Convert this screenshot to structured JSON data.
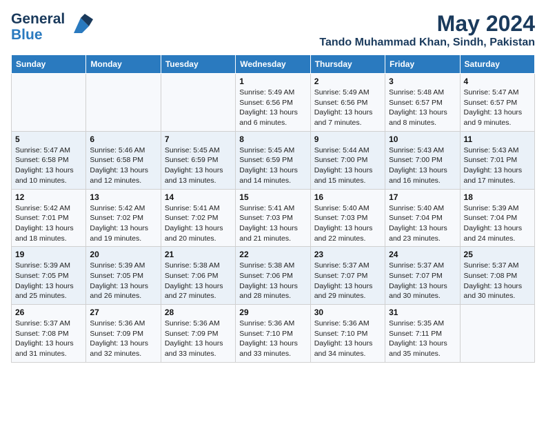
{
  "logo": {
    "line1": "General",
    "line2": "Blue"
  },
  "title": "May 2024",
  "subtitle": "Tando Muhammad Khan, Sindh, Pakistan",
  "days_of_week": [
    "Sunday",
    "Monday",
    "Tuesday",
    "Wednesday",
    "Thursday",
    "Friday",
    "Saturday"
  ],
  "weeks": [
    [
      {
        "day": "",
        "info": ""
      },
      {
        "day": "",
        "info": ""
      },
      {
        "day": "",
        "info": ""
      },
      {
        "day": "1",
        "info": "Sunrise: 5:49 AM\nSunset: 6:56 PM\nDaylight: 13 hours\nand 6 minutes."
      },
      {
        "day": "2",
        "info": "Sunrise: 5:49 AM\nSunset: 6:56 PM\nDaylight: 13 hours\nand 7 minutes."
      },
      {
        "day": "3",
        "info": "Sunrise: 5:48 AM\nSunset: 6:57 PM\nDaylight: 13 hours\nand 8 minutes."
      },
      {
        "day": "4",
        "info": "Sunrise: 5:47 AM\nSunset: 6:57 PM\nDaylight: 13 hours\nand 9 minutes."
      }
    ],
    [
      {
        "day": "5",
        "info": "Sunrise: 5:47 AM\nSunset: 6:58 PM\nDaylight: 13 hours\nand 10 minutes."
      },
      {
        "day": "6",
        "info": "Sunrise: 5:46 AM\nSunset: 6:58 PM\nDaylight: 13 hours\nand 12 minutes."
      },
      {
        "day": "7",
        "info": "Sunrise: 5:45 AM\nSunset: 6:59 PM\nDaylight: 13 hours\nand 13 minutes."
      },
      {
        "day": "8",
        "info": "Sunrise: 5:45 AM\nSunset: 6:59 PM\nDaylight: 13 hours\nand 14 minutes."
      },
      {
        "day": "9",
        "info": "Sunrise: 5:44 AM\nSunset: 7:00 PM\nDaylight: 13 hours\nand 15 minutes."
      },
      {
        "day": "10",
        "info": "Sunrise: 5:43 AM\nSunset: 7:00 PM\nDaylight: 13 hours\nand 16 minutes."
      },
      {
        "day": "11",
        "info": "Sunrise: 5:43 AM\nSunset: 7:01 PM\nDaylight: 13 hours\nand 17 minutes."
      }
    ],
    [
      {
        "day": "12",
        "info": "Sunrise: 5:42 AM\nSunset: 7:01 PM\nDaylight: 13 hours\nand 18 minutes."
      },
      {
        "day": "13",
        "info": "Sunrise: 5:42 AM\nSunset: 7:02 PM\nDaylight: 13 hours\nand 19 minutes."
      },
      {
        "day": "14",
        "info": "Sunrise: 5:41 AM\nSunset: 7:02 PM\nDaylight: 13 hours\nand 20 minutes."
      },
      {
        "day": "15",
        "info": "Sunrise: 5:41 AM\nSunset: 7:03 PM\nDaylight: 13 hours\nand 21 minutes."
      },
      {
        "day": "16",
        "info": "Sunrise: 5:40 AM\nSunset: 7:03 PM\nDaylight: 13 hours\nand 22 minutes."
      },
      {
        "day": "17",
        "info": "Sunrise: 5:40 AM\nSunset: 7:04 PM\nDaylight: 13 hours\nand 23 minutes."
      },
      {
        "day": "18",
        "info": "Sunrise: 5:39 AM\nSunset: 7:04 PM\nDaylight: 13 hours\nand 24 minutes."
      }
    ],
    [
      {
        "day": "19",
        "info": "Sunrise: 5:39 AM\nSunset: 7:05 PM\nDaylight: 13 hours\nand 25 minutes."
      },
      {
        "day": "20",
        "info": "Sunrise: 5:39 AM\nSunset: 7:05 PM\nDaylight: 13 hours\nand 26 minutes."
      },
      {
        "day": "21",
        "info": "Sunrise: 5:38 AM\nSunset: 7:06 PM\nDaylight: 13 hours\nand 27 minutes."
      },
      {
        "day": "22",
        "info": "Sunrise: 5:38 AM\nSunset: 7:06 PM\nDaylight: 13 hours\nand 28 minutes."
      },
      {
        "day": "23",
        "info": "Sunrise: 5:37 AM\nSunset: 7:07 PM\nDaylight: 13 hours\nand 29 minutes."
      },
      {
        "day": "24",
        "info": "Sunrise: 5:37 AM\nSunset: 7:07 PM\nDaylight: 13 hours\nand 30 minutes."
      },
      {
        "day": "25",
        "info": "Sunrise: 5:37 AM\nSunset: 7:08 PM\nDaylight: 13 hours\nand 30 minutes."
      }
    ],
    [
      {
        "day": "26",
        "info": "Sunrise: 5:37 AM\nSunset: 7:08 PM\nDaylight: 13 hours\nand 31 minutes."
      },
      {
        "day": "27",
        "info": "Sunrise: 5:36 AM\nSunset: 7:09 PM\nDaylight: 13 hours\nand 32 minutes."
      },
      {
        "day": "28",
        "info": "Sunrise: 5:36 AM\nSunset: 7:09 PM\nDaylight: 13 hours\nand 33 minutes."
      },
      {
        "day": "29",
        "info": "Sunrise: 5:36 AM\nSunset: 7:10 PM\nDaylight: 13 hours\nand 33 minutes."
      },
      {
        "day": "30",
        "info": "Sunrise: 5:36 AM\nSunset: 7:10 PM\nDaylight: 13 hours\nand 34 minutes."
      },
      {
        "day": "31",
        "info": "Sunrise: 5:35 AM\nSunset: 7:11 PM\nDaylight: 13 hours\nand 35 minutes."
      },
      {
        "day": "",
        "info": ""
      }
    ]
  ]
}
